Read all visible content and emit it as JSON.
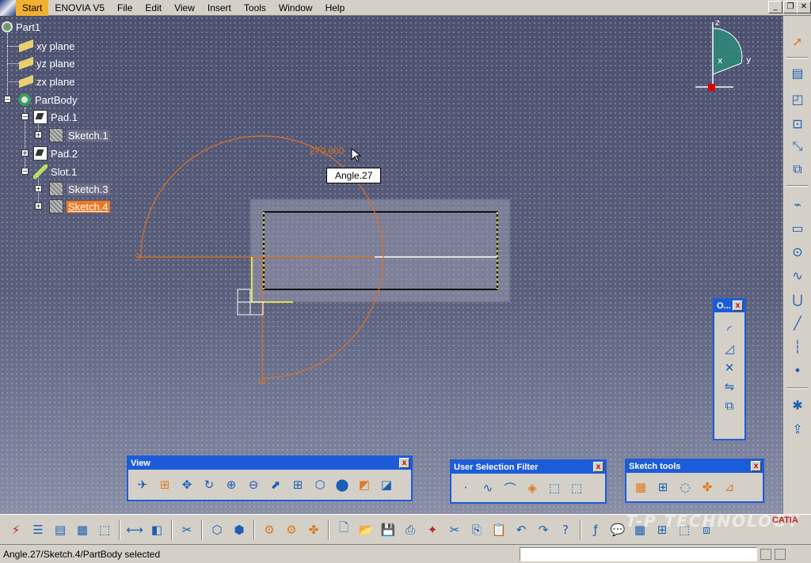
{
  "menubar": {
    "items": [
      "Start",
      "ENOVIA V5",
      "File",
      "Edit",
      "View",
      "Insert",
      "Tools",
      "Window",
      "Help"
    ]
  },
  "tree": {
    "nodes": [
      {
        "label": "Part1"
      },
      {
        "label": "xy plane"
      },
      {
        "label": "yz plane"
      },
      {
        "label": "zx plane"
      },
      {
        "label": "PartBody"
      },
      {
        "label": "Pad.1"
      },
      {
        "label": "Sketch.1"
      },
      {
        "label": "Pad.2"
      },
      {
        "label": "Slot.1"
      },
      {
        "label": "Sketch.3"
      },
      {
        "label": "Sketch.4"
      }
    ]
  },
  "compass": {
    "z_label": "z",
    "x_label": "x",
    "y_label": "y"
  },
  "viewport": {
    "dimension_value": "270.000",
    "tooltip": "Angle.27",
    "accent_color": "#e07020"
  },
  "toolbars": {
    "view": {
      "title": "View",
      "close": "x"
    },
    "selection_filter": {
      "title": "User Selection Filter",
      "close": "x"
    },
    "sketch_tools": {
      "title": "Sketch tools",
      "close": "x"
    },
    "operation": {
      "title": "O...",
      "close": "x"
    }
  },
  "statusbar": {
    "text": "Angle.27/Sketch.4/PartBody selected",
    "command_value": ""
  },
  "branding": {
    "watermark": "T-P TECHNOLOGY",
    "logo": "CATIA"
  }
}
